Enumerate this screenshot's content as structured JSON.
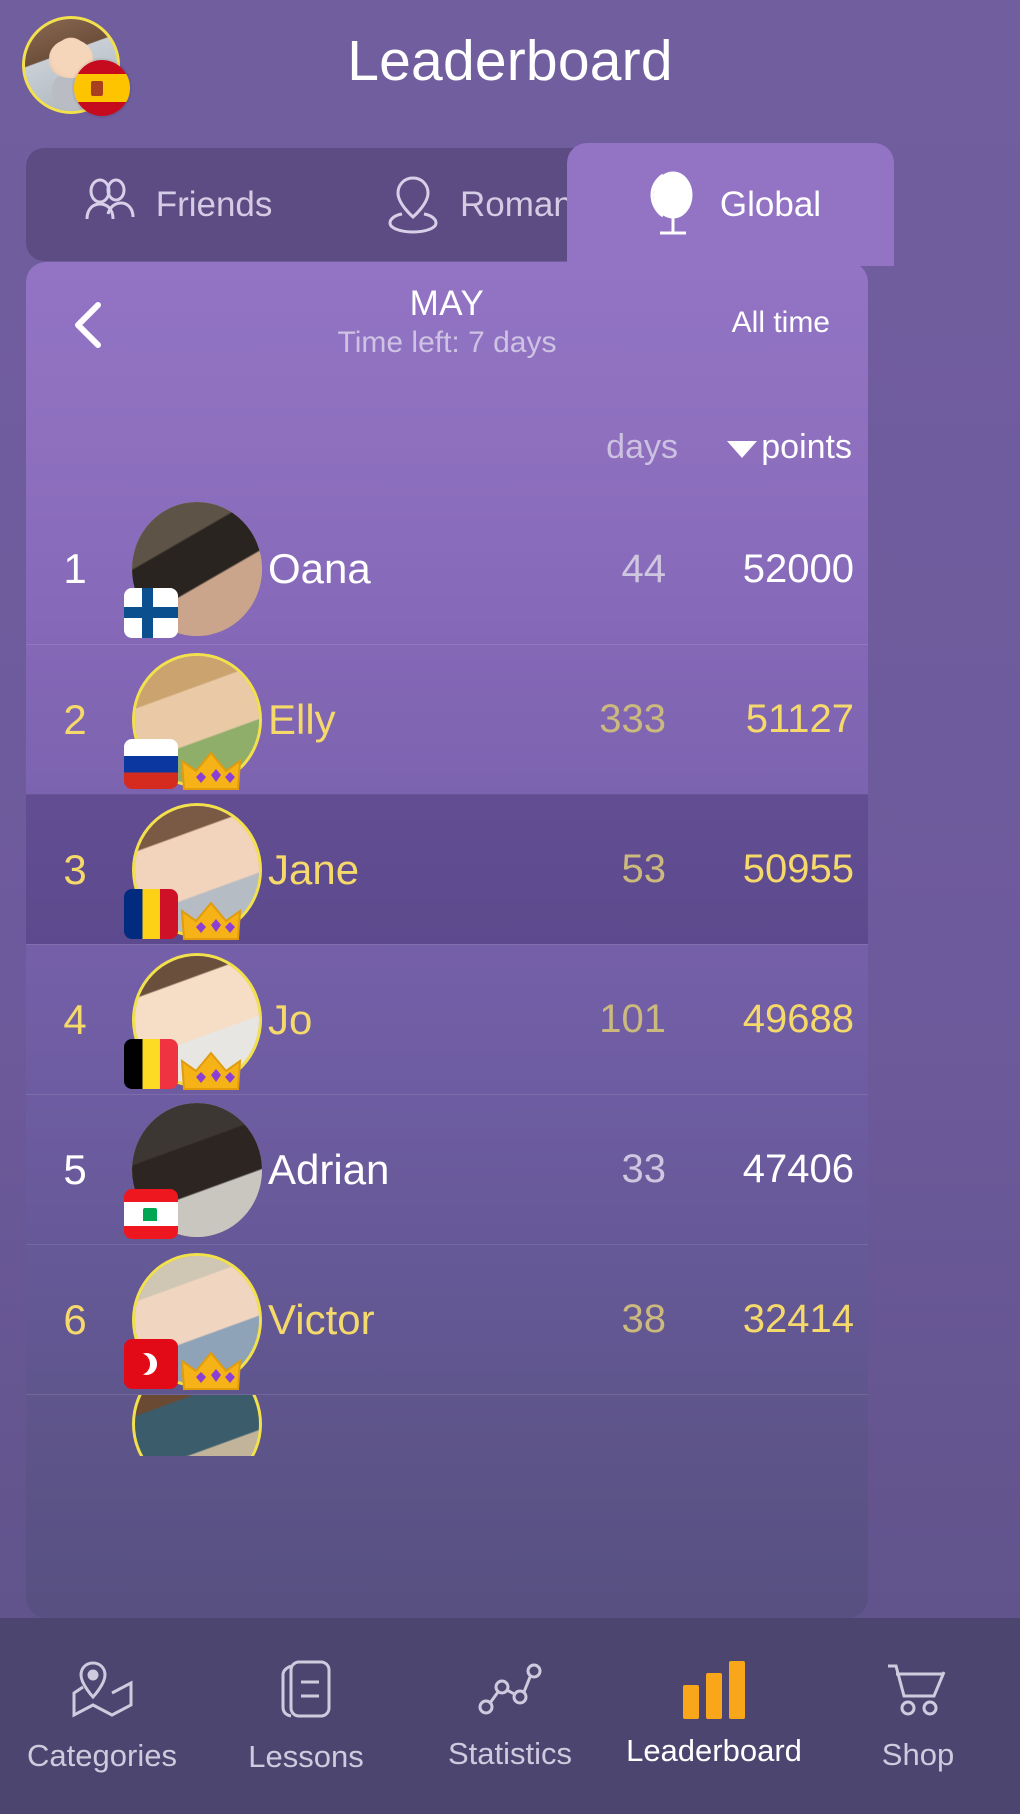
{
  "header": {
    "title": "Leaderboard",
    "avatar_name": "user-avatar",
    "avatar_flag": "spain-flag-badge"
  },
  "tabs": [
    {
      "label": "Friends",
      "icon": "friends-icon",
      "active": false
    },
    {
      "label": "Romania",
      "icon": "country-pin-icon",
      "active": false
    },
    {
      "label": "Global",
      "icon": "globe-icon",
      "active": true
    }
  ],
  "period": {
    "back_icon": "chevron-left-icon",
    "month": "MAY",
    "time_left": "Time left: 7 days",
    "all_time": "All time"
  },
  "columns": {
    "days": "days",
    "points": "points",
    "sort_icon": "caret-down-icon",
    "sorted_by": "points"
  },
  "rows": [
    {
      "rank": "1",
      "name": "Oana",
      "days": "44",
      "points": "52000",
      "flag": "finland-flag",
      "crown": false,
      "gold": false,
      "me": false
    },
    {
      "rank": "2",
      "name": "Elly",
      "days": "333",
      "points": "51127",
      "flag": "russia-flag",
      "crown": true,
      "gold": true,
      "me": false
    },
    {
      "rank": "3",
      "name": "Jane",
      "days": "53",
      "points": "50955",
      "flag": "romania-flag",
      "crown": true,
      "gold": true,
      "me": true
    },
    {
      "rank": "4",
      "name": "Jo",
      "days": "101",
      "points": "49688",
      "flag": "belgium-flag",
      "crown": true,
      "gold": true,
      "me": false
    },
    {
      "rank": "5",
      "name": "Adrian",
      "days": "33",
      "points": "47406",
      "flag": "lebanon-flag",
      "crown": false,
      "gold": false,
      "me": false
    },
    {
      "rank": "6",
      "name": "Victor",
      "days": "38",
      "points": "32414",
      "flag": "turkey-flag",
      "crown": true,
      "gold": true,
      "me": false
    }
  ],
  "bottom_nav": [
    {
      "label": "Categories",
      "icon": "map-pin-icon",
      "active": false
    },
    {
      "label": "Lessons",
      "icon": "book-icon",
      "active": false
    },
    {
      "label": "Statistics",
      "icon": "line-chart-icon",
      "active": false
    },
    {
      "label": "Leaderboard",
      "icon": "bar-chart-icon",
      "active": true
    },
    {
      "label": "Shop",
      "icon": "cart-icon",
      "active": false
    }
  ],
  "colors": {
    "background": "#6d5a9c",
    "panel_top": "#9273c4",
    "panel_bottom": "#575080",
    "tab_inactive": "#5d4c83",
    "gold": "#f5d96b",
    "accent_orange": "#f9a61a",
    "nav_bar": "#4b4570",
    "highlight_row": "#5a5083"
  }
}
